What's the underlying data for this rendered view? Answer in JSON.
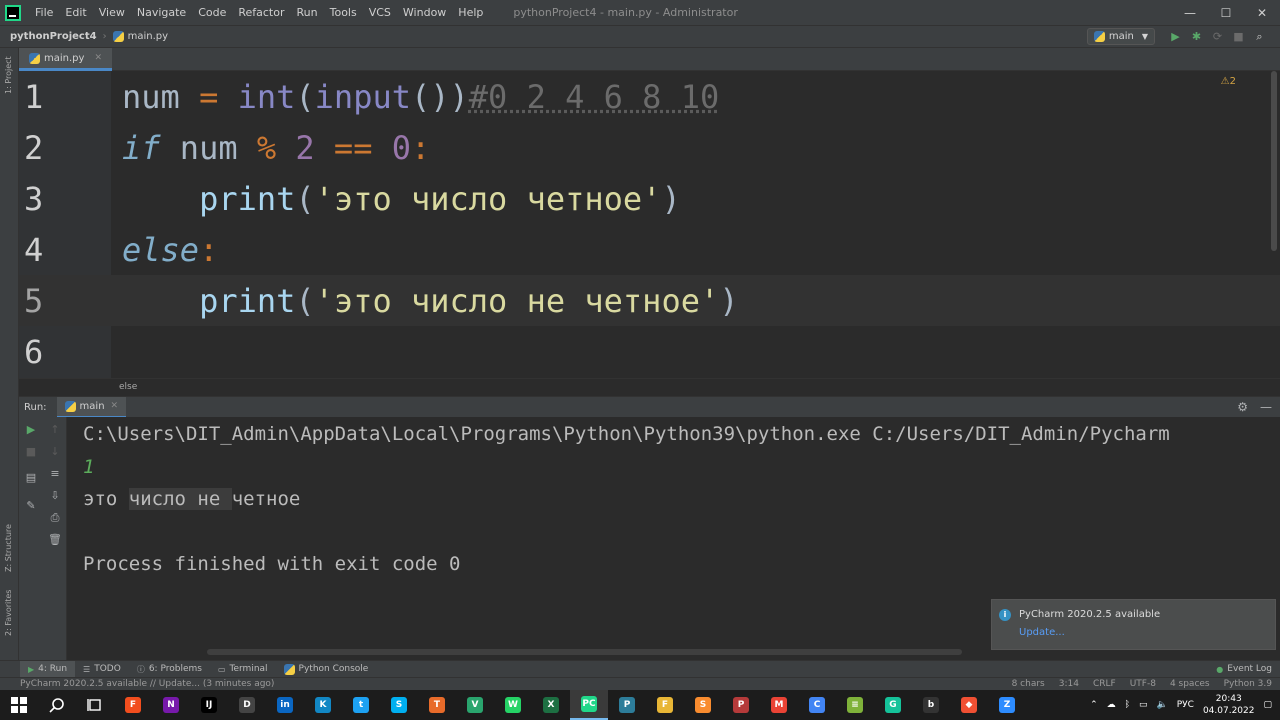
{
  "menubar": {
    "items": [
      "File",
      "Edit",
      "View",
      "Navigate",
      "Code",
      "Refactor",
      "Run",
      "Tools",
      "VCS",
      "Window",
      "Help"
    ],
    "window_title": "pythonProject4 - main.py - Administrator",
    "controls": [
      "—",
      "☐",
      "✕"
    ]
  },
  "navbar": {
    "project": "pythonProject4",
    "file": "main.py",
    "run_config": "main",
    "tool_icons": [
      "▶",
      "✱",
      "⟳",
      "■",
      "⌕"
    ]
  },
  "left_strip": {
    "project_label": "1: Project",
    "structure_label": "Z: Structure",
    "favorites_label": "2: Favorites"
  },
  "editor": {
    "tab_label": "main.py",
    "warning_count": "⚠2",
    "lines": [
      {
        "num": "1",
        "tokens": [
          [
            "t-plain",
            "num "
          ],
          [
            "t-op",
            "= "
          ],
          [
            "t-builtin",
            "int"
          ],
          [
            "t-paren",
            "("
          ],
          [
            "t-builtin",
            "input"
          ],
          [
            "t-paren",
            "())"
          ],
          [
            "t-comment",
            "#0 2 4 6 8 10"
          ]
        ]
      },
      {
        "num": "2",
        "tokens": [
          [
            "t-kw",
            "if"
          ],
          [
            "t-plain",
            " num "
          ],
          [
            "t-op",
            "% "
          ],
          [
            "t-num",
            "2 "
          ],
          [
            "t-op",
            "== "
          ],
          [
            "t-num",
            "0"
          ],
          [
            "t-colon",
            ":"
          ]
        ]
      },
      {
        "num": "3",
        "tokens": [
          [
            "t-plain",
            "    "
          ],
          [
            "t-fn",
            "print"
          ],
          [
            "t-paren",
            "("
          ],
          [
            "t-str",
            "'это число четное'"
          ],
          [
            "t-paren",
            ")"
          ]
        ]
      },
      {
        "num": "4",
        "tokens": [
          [
            "t-kw",
            "else"
          ],
          [
            "t-colon",
            ":"
          ]
        ]
      },
      {
        "num": "5",
        "tokens": [
          [
            "t-plain",
            "    "
          ],
          [
            "t-fn",
            "print"
          ],
          [
            "t-paren",
            "("
          ],
          [
            "t-str",
            "'это число не четное'"
          ],
          [
            "t-paren",
            ")"
          ]
        ]
      },
      {
        "num": "6",
        "tokens": []
      }
    ],
    "current_line": 5,
    "breadcrumb": "else"
  },
  "run_panel": {
    "label": "Run:",
    "tab": "main",
    "console": {
      "command": "C:\\Users\\DIT_Admin\\AppData\\Local\\Programs\\Python\\Python39\\python.exe C:/Users/DIT_Admin/Pycharm",
      "user_input": "1",
      "output_before": "это ",
      "output_selected": "число не ",
      "output_after": "четное",
      "exit": "Process finished with exit code 0"
    }
  },
  "notification": {
    "title": "PyCharm 2020.2.5 available",
    "link": "Update..."
  },
  "bottombar": {
    "run": "4: Run",
    "todo": "TODO",
    "problems": "6: Problems",
    "terminal": "Terminal",
    "python_console": "Python Console",
    "event_log": "Event Log"
  },
  "statusbar": {
    "message": "PyCharm 2020.2.5 available // Update... (3 minutes ago)",
    "chars": "8 chars",
    "position": "3:14",
    "line_sep": "CRLF",
    "encoding": "UTF-8",
    "indent": "4 spaces",
    "interpreter": "Python 3.9"
  },
  "taskbar": {
    "apps": [
      {
        "name": "figma",
        "color": "#f24e1e",
        "glyph": "F"
      },
      {
        "name": "onenote",
        "color": "#7719aa",
        "glyph": "N"
      },
      {
        "name": "intellij",
        "color": "#000000",
        "glyph": "IJ"
      },
      {
        "name": "devtools",
        "color": "#444444",
        "glyph": "D"
      },
      {
        "name": "linkedin",
        "color": "#0a66c2",
        "glyph": "in"
      },
      {
        "name": "kodi",
        "color": "#1287c4",
        "glyph": "K"
      },
      {
        "name": "twitter",
        "color": "#1da1f2",
        "glyph": "t"
      },
      {
        "name": "skype",
        "color": "#00aff0",
        "glyph": "S"
      },
      {
        "name": "telegram",
        "color": "#e86b2a",
        "glyph": "T"
      },
      {
        "name": "vpn",
        "color": "#2aa56e",
        "glyph": "V"
      },
      {
        "name": "whatsapp",
        "color": "#25d366",
        "glyph": "W"
      },
      {
        "name": "excel",
        "color": "#1d6f42",
        "glyph": "X"
      },
      {
        "name": "pycharm",
        "color": "#21d789",
        "glyph": "PC"
      },
      {
        "name": "photos",
        "color": "#2d7d9a",
        "glyph": "P"
      },
      {
        "name": "files",
        "color": "#e8b636",
        "glyph": "F"
      },
      {
        "name": "sublime",
        "color": "#f98c2f",
        "glyph": "S"
      },
      {
        "name": "paint",
        "color": "#b53a3a",
        "glyph": "P"
      },
      {
        "name": "gmail",
        "color": "#ea4335",
        "glyph": "M"
      },
      {
        "name": "chrome",
        "color": "#4285f4",
        "glyph": "C"
      },
      {
        "name": "stack",
        "color": "#7fb23a",
        "glyph": "≡"
      },
      {
        "name": "grammarly",
        "color": "#15c39a",
        "glyph": "G"
      },
      {
        "name": "bear",
        "color": "#333333",
        "glyph": "b"
      },
      {
        "name": "git",
        "color": "#f05033",
        "glyph": "◆"
      },
      {
        "name": "zoom",
        "color": "#2d8cff",
        "glyph": "Z"
      }
    ],
    "lang": "РУС",
    "time": "20:43",
    "date": "04.07.2022"
  }
}
